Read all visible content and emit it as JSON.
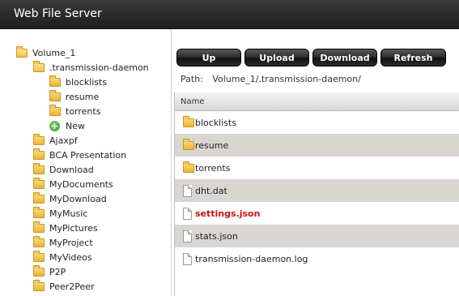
{
  "window": {
    "title": "Web File Server"
  },
  "toolbar": {
    "up_label": "Up",
    "upload_label": "Upload",
    "download_label": "Download",
    "refresh_label": "Refresh"
  },
  "path": {
    "label": "Path:",
    "value": "Volume_1/.transmission-daemon/"
  },
  "tree": {
    "root": "Volume_1",
    "current": ".transmission-daemon",
    "children": [
      "blocklists",
      "resume",
      "torrents"
    ],
    "new_label": "New",
    "siblings": [
      "Ajaxpf",
      "BCA Presentation",
      "Download",
      "MyDocuments",
      "MyDownload",
      "MyMusic",
      "MyPictures",
      "MyProject",
      "MyVideos",
      "P2P",
      "Peer2Peer"
    ]
  },
  "filelist": {
    "header_name": "Name",
    "rows": [
      {
        "name": "blocklists",
        "type": "folder-icon"
      },
      {
        "name": "resume",
        "type": "folder-icon"
      },
      {
        "name": "torrents",
        "type": "folder-icon"
      },
      {
        "name": "dht.dat",
        "type": "file-icon"
      },
      {
        "name": "settings.json",
        "type": "file-icon"
      },
      {
        "name": "stats.json",
        "type": "file-icon"
      },
      {
        "name": "transmission-daemon.log",
        "type": "file-icon"
      }
    ]
  },
  "colors": {
    "titlebar": "#2a2a2a",
    "row_shade": "#d9d6d2",
    "highlight_text": "#cc1111"
  }
}
